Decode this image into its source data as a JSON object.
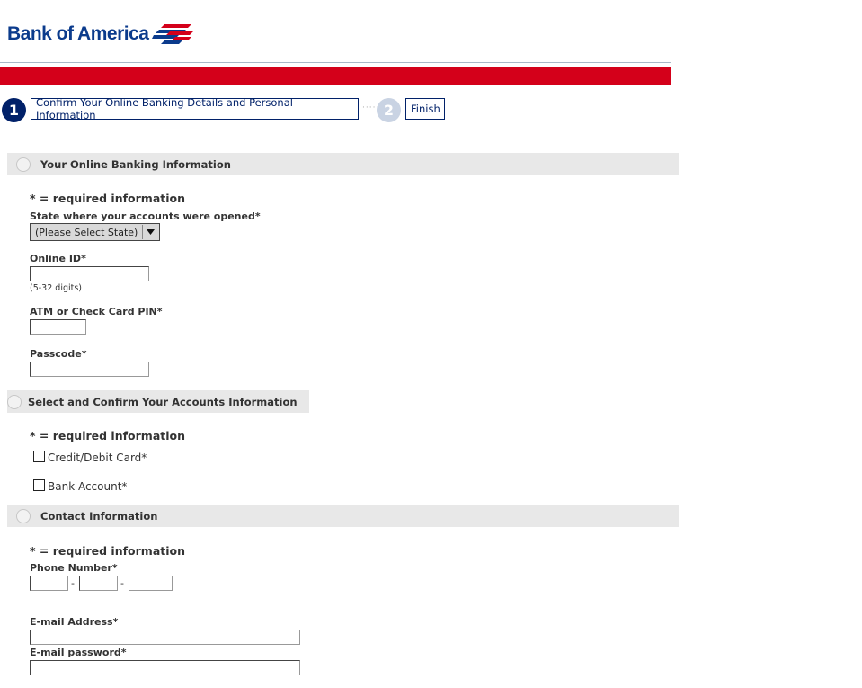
{
  "header": {
    "logo_text": "Bank of America",
    "brand_colors": {
      "red": "#d4001a",
      "navy": "#012169"
    }
  },
  "steps": [
    {
      "number": "1",
      "label": "Confirm Your Online Banking Details and Personal Information",
      "active": true
    },
    {
      "number": "2",
      "label": "Finish",
      "active": false
    }
  ],
  "sections": {
    "banking": {
      "title": "Your Online Banking Information",
      "required_note": "* = required information",
      "state_label": "State where your accounts were opened*",
      "state_selected": "(Please Select State)",
      "online_id_label": "Online ID*",
      "online_id_value": "",
      "online_id_hint": "(5-32 digits)",
      "pin_label": "ATM or Check Card PIN*",
      "pin_value": "",
      "passcode_label": "Passcode*",
      "passcode_value": ""
    },
    "accounts": {
      "title": "Select and Confirm Your Accounts Information",
      "required_note": "* = required information",
      "credit_debit_label": "Credit/Debit Card*",
      "bank_account_label": "Bank Account*"
    },
    "contact": {
      "title": "Contact Information",
      "required_note": "* = required information",
      "phone_label": "Phone Number*",
      "phone_separator": "-",
      "phone_area": "",
      "phone_prefix": "",
      "phone_line": "",
      "email_label": "E-mail Address*",
      "email_value": "",
      "email_password_label": "E-mail password*",
      "email_password_value": ""
    }
  }
}
